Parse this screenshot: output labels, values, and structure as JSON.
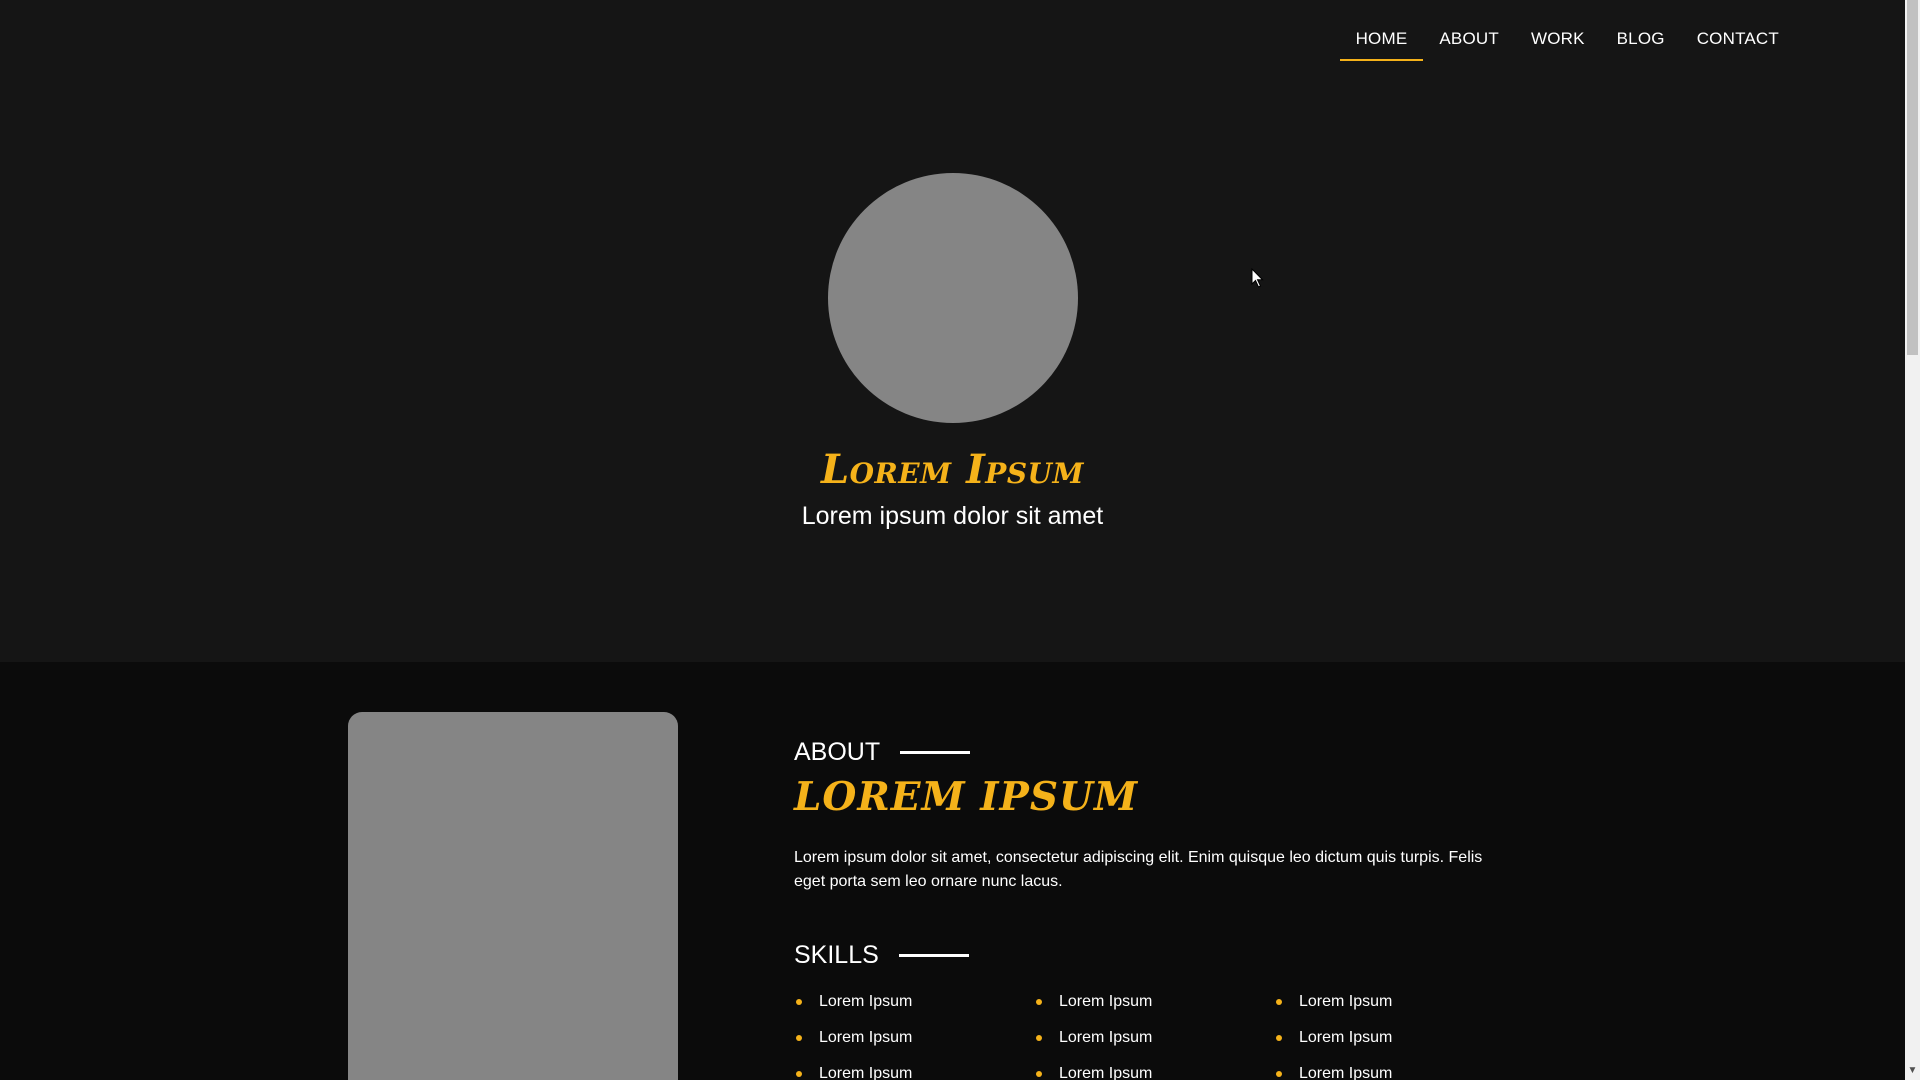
{
  "nav": {
    "items": [
      {
        "label": "HOME",
        "active": true
      },
      {
        "label": "ABOUT",
        "active": false
      },
      {
        "label": "WORK",
        "active": false
      },
      {
        "label": "BLOG",
        "active": false
      },
      {
        "label": "CONTACT",
        "active": false
      }
    ]
  },
  "hero": {
    "name": "Lorem Ipsum",
    "subtitle": "Lorem ipsum dolor sit amet"
  },
  "about": {
    "heading": "ABOUT",
    "title": "LOREM IPSUM",
    "text": "Lorem ipsum dolor sit amet, consectetur adipiscing elit. Enim quisque leo dictum quis turpis. Felis eget porta sem leo ornare nunc lacus.",
    "skills_heading": "SKILLS",
    "skills": [
      "Lorem Ipsum",
      "Lorem Ipsum",
      "Lorem Ipsum",
      "Lorem Ipsum",
      "Lorem Ipsum",
      "Lorem Ipsum",
      "Lorem Ipsum",
      "Lorem Ipsum",
      "Lorem Ipsum"
    ]
  },
  "colors": {
    "accent": "#f5b21a",
    "hero_bg": "#151515",
    "about_bg": "#0b0b0b",
    "placeholder": "#858585"
  },
  "icons": {
    "cursor": "mouse-pointer-icon",
    "scroll_down": "chevron-down-icon"
  }
}
